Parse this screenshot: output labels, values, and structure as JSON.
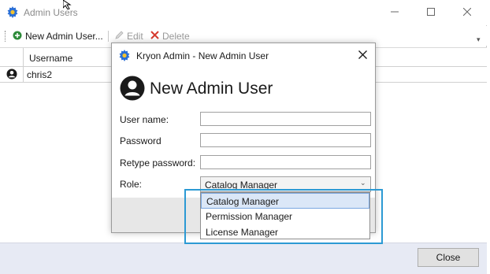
{
  "main_window": {
    "title": "Admin Users",
    "toolbar": {
      "new_label": "New Admin User...",
      "edit_label": "Edit",
      "delete_label": "Delete"
    },
    "grid": {
      "columns": [
        "Username"
      ],
      "rows": [
        {
          "username": "chris2"
        }
      ]
    },
    "close_label": "Close"
  },
  "dialog": {
    "title": "Kryon Admin - New Admin User",
    "heading": "New Admin User",
    "fields": {
      "username_label": "User name:",
      "username_value": "",
      "password_label": "Password",
      "password_value": "",
      "retype_label": "Retype password:",
      "retype_value": "",
      "role_label": "Role:",
      "role_selected": "Catalog Manager"
    },
    "role_options": [
      "Catalog Manager",
      "Permission Manager",
      "License Manager"
    ]
  },
  "colors": {
    "highlight_border": "#2c9ad4",
    "selected_option_bg": "#dbe7f7",
    "footer_bg": "#e7eaf4",
    "add_icon": "#2e8b3a",
    "delete_icon": "#d63b2f",
    "app_icon": "#2a6fd6"
  },
  "icons": {
    "app": "gear-logo-icon",
    "add": "plus-circle-icon",
    "edit": "pencil-icon",
    "delete": "x-delete-icon",
    "user": "user-avatar-icon",
    "dropdown": "chevron-down-icon",
    "cursor": "mouse-cursor-icon"
  }
}
